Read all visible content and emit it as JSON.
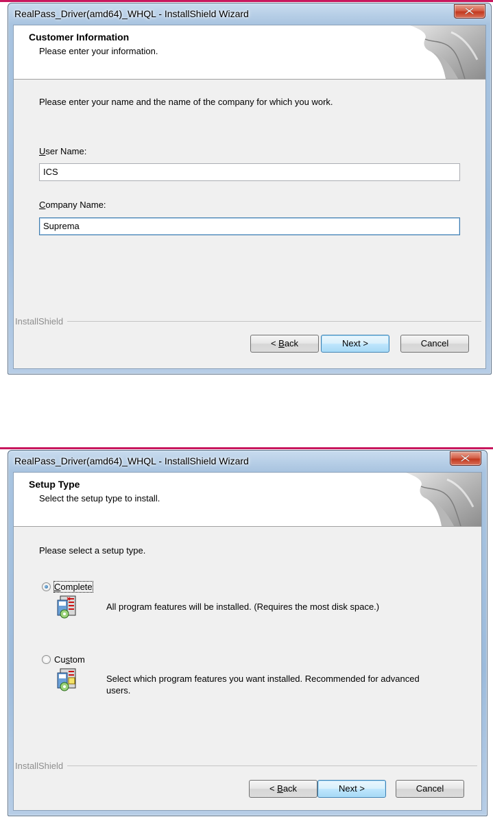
{
  "colors": {
    "accent_line": "#c8175d",
    "close_button": "#c2391f",
    "default_button_border": "#3c7fb1"
  },
  "customer_window": {
    "title": "RealPass_Driver(amd64)_WHQL - InstallShield Wizard",
    "header_title": "Customer Information",
    "header_subtitle": "Please enter your information.",
    "instruction": "Please enter your name and the name of the company for which you work.",
    "user_name_label_mnemonic": "U",
    "user_name_label_rest": "ser Name:",
    "user_name_value": "ICS",
    "company_label_mnemonic": "C",
    "company_label_rest": "ompany Name:",
    "company_value": "Suprema",
    "brand": "InstallShield",
    "back_prefix": "< ",
    "back_mnemonic": "B",
    "back_rest": "ack",
    "next_label": "Next >",
    "cancel_label": "Cancel",
    "close_icon": "close-x-icon"
  },
  "setup_window": {
    "title": "RealPass_Driver(amd64)_WHQL - InstallShield Wizard",
    "header_title": "Setup Type",
    "header_subtitle": "Select the setup type to install.",
    "instruction": "Please select a setup type.",
    "options": [
      {
        "mnemonic": "C",
        "label_rest": "omplete",
        "selected": true,
        "description": "All program features will be installed. (Requires the most disk space.)",
        "icon": "setup-complete-icon"
      },
      {
        "label_pre": "Cu",
        "mnemonic": "s",
        "label_rest": "tom",
        "selected": false,
        "description": "Select which program features you want installed. Recommended for advanced users.",
        "icon": "setup-custom-icon"
      }
    ],
    "brand": "InstallShield",
    "back_prefix": "< ",
    "back_mnemonic": "B",
    "back_rest": "ack",
    "next_label": "Next >",
    "cancel_label": "Cancel",
    "close_icon": "close-x-icon"
  }
}
